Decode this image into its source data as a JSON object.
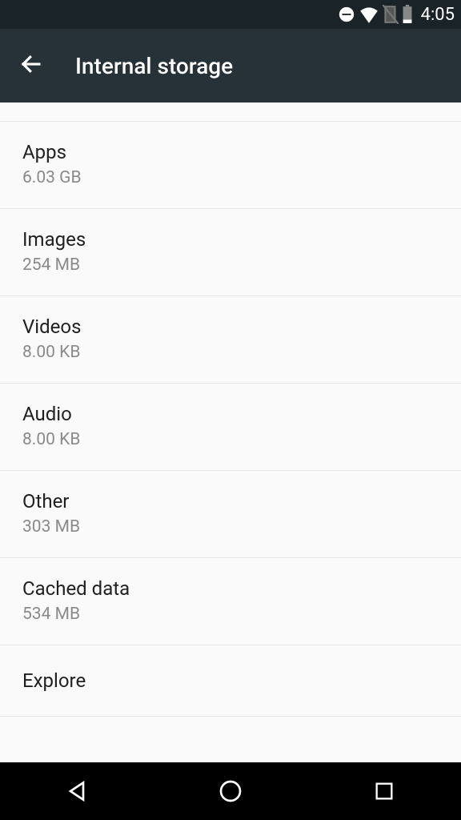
{
  "status": {
    "time": "4:05"
  },
  "header": {
    "title": "Internal storage"
  },
  "items": [
    {
      "title": "Apps",
      "subtitle": "6.03 GB"
    },
    {
      "title": "Images",
      "subtitle": "254 MB"
    },
    {
      "title": "Videos",
      "subtitle": "8.00 KB"
    },
    {
      "title": "Audio",
      "subtitle": "8.00 KB"
    },
    {
      "title": "Other",
      "subtitle": "303 MB"
    },
    {
      "title": "Cached data",
      "subtitle": "534 MB"
    },
    {
      "title": "Explore",
      "subtitle": null
    }
  ]
}
